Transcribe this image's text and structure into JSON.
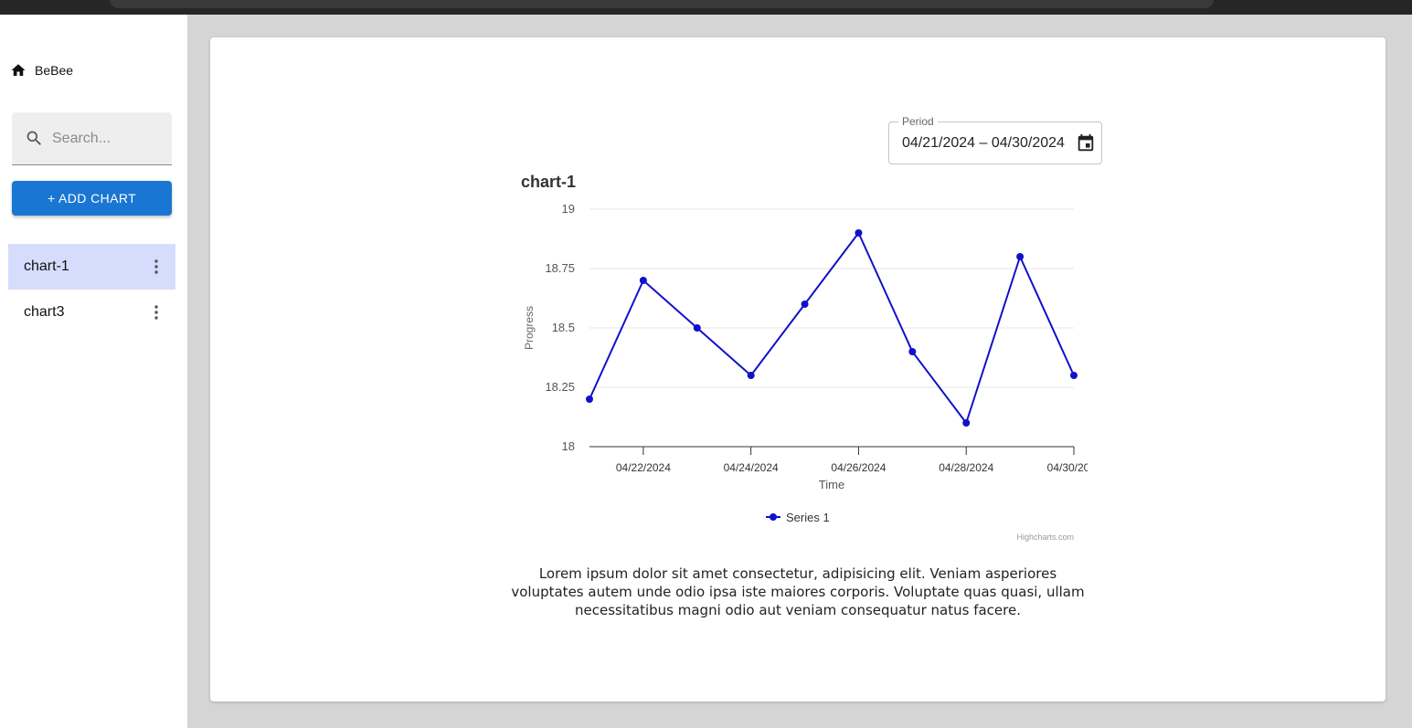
{
  "sidebar": {
    "brand": "BeBee",
    "search_placeholder": "Search...",
    "add_button": "+ ADD CHART",
    "items": [
      {
        "label": "chart-1",
        "active": true
      },
      {
        "label": "chart3",
        "active": false
      }
    ]
  },
  "period": {
    "label": "Period",
    "value": "04/21/2024 – 04/30/2024"
  },
  "chart_data": {
    "type": "line",
    "title": "chart-1",
    "xlabel": "Time",
    "ylabel": "Progress",
    "x": [
      "04/21/2024",
      "04/22/2024",
      "04/23/2024",
      "04/24/2024",
      "04/25/2024",
      "04/26/2024",
      "04/27/2024",
      "04/28/2024",
      "04/29/2024",
      "04/30/2024"
    ],
    "series": [
      {
        "name": "Series 1",
        "values": [
          18.2,
          18.7,
          18.5,
          18.3,
          18.6,
          18.9,
          18.4,
          18.1,
          18.8,
          18.3
        ],
        "color": "#1111c9"
      }
    ],
    "ylim": [
      18,
      19
    ],
    "yticks": [
      18,
      18.25,
      18.5,
      18.75,
      19
    ],
    "ytick_labels": [
      "18",
      "18.25",
      "18.5",
      "18.75",
      "19"
    ],
    "xtick_labels": [
      "04/22/2024",
      "04/24/2024",
      "04/26/2024",
      "04/28/2024",
      "04/30/20…"
    ],
    "xtick_index": [
      1,
      3,
      5,
      7,
      9
    ],
    "legend": "bottom-center",
    "grid": true,
    "credits": "Highcharts.com"
  },
  "description": "Lorem ipsum dolor sit amet consectetur, adipisicing elit. Veniam asperiores voluptates autem unde odio ipsa iste maiores corporis. Voluptate quas quasi, ullam necessitatibus magni odio aut veniam consequatur natus facere."
}
